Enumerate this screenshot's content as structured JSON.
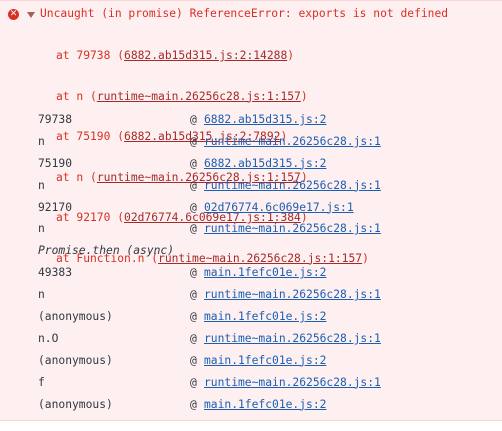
{
  "error": {
    "header": "Uncaught (in promise) ReferenceError: exports is not defined",
    "stack": [
      {
        "prefix": "at 79738 (",
        "link": "6882.ab15d315.js:2:14288",
        "suffix": ")"
      },
      {
        "prefix": "at n (",
        "link": "runtime~main.26256c28.js:1:157",
        "suffix": ")"
      },
      {
        "prefix": "at 75190 (",
        "link": "6882.ab15d315.js:2:7892",
        "suffix": ")"
      },
      {
        "prefix": "at n (",
        "link": "runtime~main.26256c28.js:1:157",
        "suffix": ")"
      },
      {
        "prefix": "at 92170 (",
        "link": "02d76774.6c069e17.js:1:384",
        "suffix": ")"
      },
      {
        "prefix": "at Function.n (",
        "link": "runtime~main.26256c28.js:1:157",
        "suffix": ")"
      }
    ]
  },
  "frames": [
    {
      "fn": "79738",
      "loc": "6882.ab15d315.js:2"
    },
    {
      "fn": "n",
      "loc": "runtime~main.26256c28.js:1"
    },
    {
      "fn": "75190",
      "loc": "6882.ab15d315.js:2"
    },
    {
      "fn": "n",
      "loc": "runtime~main.26256c28.js:1"
    },
    {
      "fn": "92170",
      "loc": "02d76774.6c069e17.js:1"
    },
    {
      "fn": "n",
      "loc": "runtime~main.26256c28.js:1"
    }
  ],
  "async_label": "Promise.then (async)",
  "async_frames": [
    {
      "fn": "49383",
      "loc": "main.1fefc01e.js:2"
    },
    {
      "fn": "n",
      "loc": "runtime~main.26256c28.js:1"
    },
    {
      "fn": "(anonymous)",
      "loc": "main.1fefc01e.js:2"
    },
    {
      "fn": "n.O",
      "loc": "runtime~main.26256c28.js:1"
    },
    {
      "fn": "(anonymous)",
      "loc": "main.1fefc01e.js:2"
    },
    {
      "fn": "f",
      "loc": "runtime~main.26256c28.js:1"
    },
    {
      "fn": "(anonymous)",
      "loc": "main.1fefc01e.js:2"
    }
  ],
  "at_symbol": "@",
  "icons": {
    "error": "error-circle-icon",
    "disclosure": "triangle-down-icon"
  },
  "colors": {
    "error_text": "#d93025",
    "link": "#1a5fb4",
    "background": "#fef0f0"
  }
}
